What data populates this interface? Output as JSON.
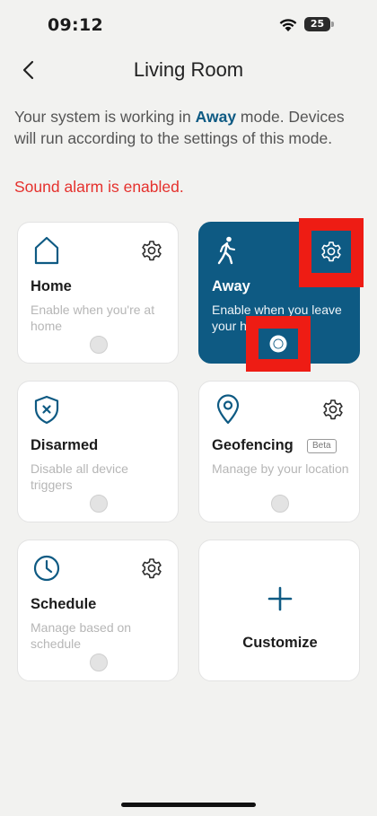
{
  "status_bar": {
    "time": "09:12",
    "battery": "25",
    "wifi_icon": "wifi-icon"
  },
  "header": {
    "title": "Living Room",
    "back_icon": "chevron-left-icon"
  },
  "info": {
    "prefix": "Your system is working in ",
    "mode": "Away",
    "suffix": " mode. Devices will run according to the settings of this mode.",
    "alarm": "Sound alarm is enabled."
  },
  "colors": {
    "accent": "#0e5a83",
    "alarm": "#e5312d",
    "highlight": "#ee1c14",
    "background": "#f2f2f0"
  },
  "modes": [
    {
      "title": "Home",
      "desc": "Enable when you're at home",
      "icon": "home-icon",
      "active": false,
      "has_settings": true
    },
    {
      "title": "Away",
      "desc": "Enable when you leave your h",
      "icon": "walking-icon",
      "active": true,
      "has_settings": true
    },
    {
      "title": "Disarmed",
      "desc": "Disable all device triggers",
      "icon": "shield-x-icon",
      "active": false,
      "has_settings": false
    },
    {
      "title": "Geofencing",
      "desc": "Manage by your location",
      "icon": "location-pin-icon",
      "active": false,
      "has_settings": true,
      "badge": "Beta"
    },
    {
      "title": "Schedule",
      "desc": "Manage based on schedule",
      "icon": "clock-icon",
      "active": false,
      "has_settings": true
    }
  ],
  "customize": {
    "label": "Customize",
    "icon": "plus-icon"
  }
}
